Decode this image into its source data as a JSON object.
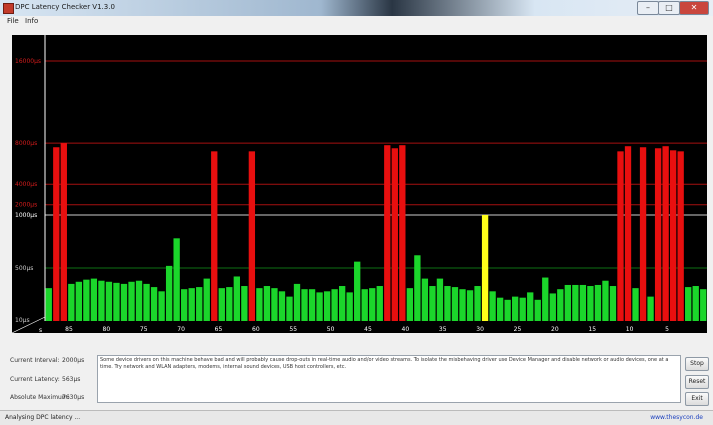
{
  "window": {
    "title": "DPC Latency Checker V1.3.0",
    "minimize": "–",
    "maximize": "□",
    "close": "✕"
  },
  "menu": {
    "items": [
      "File",
      "Info"
    ]
  },
  "chart_data": {
    "type": "bar",
    "yscale": "non-linear (bottom 40% linear 0–1000µs, upper 60% linear 1000–16000µs)",
    "ytick_labels": [
      "10µs",
      "500µs",
      "1000µs",
      "2000µs",
      "4000µs",
      "8000µs",
      "16000µs"
    ],
    "ytick_values": [
      10,
      500,
      1000,
      2000,
      4000,
      8000,
      16000
    ],
    "xtick_labels": [
      "85",
      "80",
      "75",
      "70",
      "65",
      "60",
      "55",
      "50",
      "45",
      "40",
      "35",
      "30",
      "25",
      "20",
      "15",
      "10",
      "5"
    ],
    "xlabel": "s",
    "ylabel": "µs",
    "values_us": [
      310,
      7600,
      8000,
      350,
      370,
      390,
      400,
      380,
      370,
      360,
      350,
      370,
      380,
      350,
      320,
      280,
      520,
      780,
      300,
      310,
      320,
      400,
      7200,
      310,
      320,
      420,
      330,
      7200,
      310,
      330,
      310,
      280,
      230,
      350,
      300,
      300,
      270,
      280,
      300,
      330,
      270,
      560,
      300,
      310,
      330,
      7800,
      7500,
      7800,
      310,
      620,
      400,
      330,
      400,
      330,
      320,
      300,
      290,
      330,
      1000,
      280,
      220,
      200,
      230,
      220,
      270,
      200,
      410,
      260,
      300,
      340,
      340,
      340,
      330,
      340,
      380,
      330,
      7200,
      7700,
      310,
      7600,
      230,
      7500,
      7700,
      7300,
      7200,
      320,
      330,
      300
    ],
    "colors": {
      "green": "#1bd62b",
      "yellow": "#ffff1a",
      "red": "#e80f0f"
    },
    "thresholds": {
      "yellow_min": 1000,
      "red_min": 2000
    }
  },
  "stats": [
    {
      "label": "Current Interval:",
      "value": "2000µs"
    },
    {
      "label": "Current Latency:",
      "value": "563µs"
    },
    {
      "label": "Absolute Maximum:",
      "value": "7630µs"
    }
  ],
  "message": "Some device drivers on this machine behave bad and will probably cause drop-outs in real-time audio and/or video streams. To isolate the misbehaving driver use Device Manager and disable network or audio devices, one at a time. Try network and WLAN adapters, modems, internal sound devices, USB host controllers, etc.",
  "buttons": {
    "stop": "Stop",
    "reset": "Reset",
    "exit": "Exit"
  },
  "status": {
    "text": "Analysing DPC latency ...",
    "url": "www.thesycon.de"
  }
}
